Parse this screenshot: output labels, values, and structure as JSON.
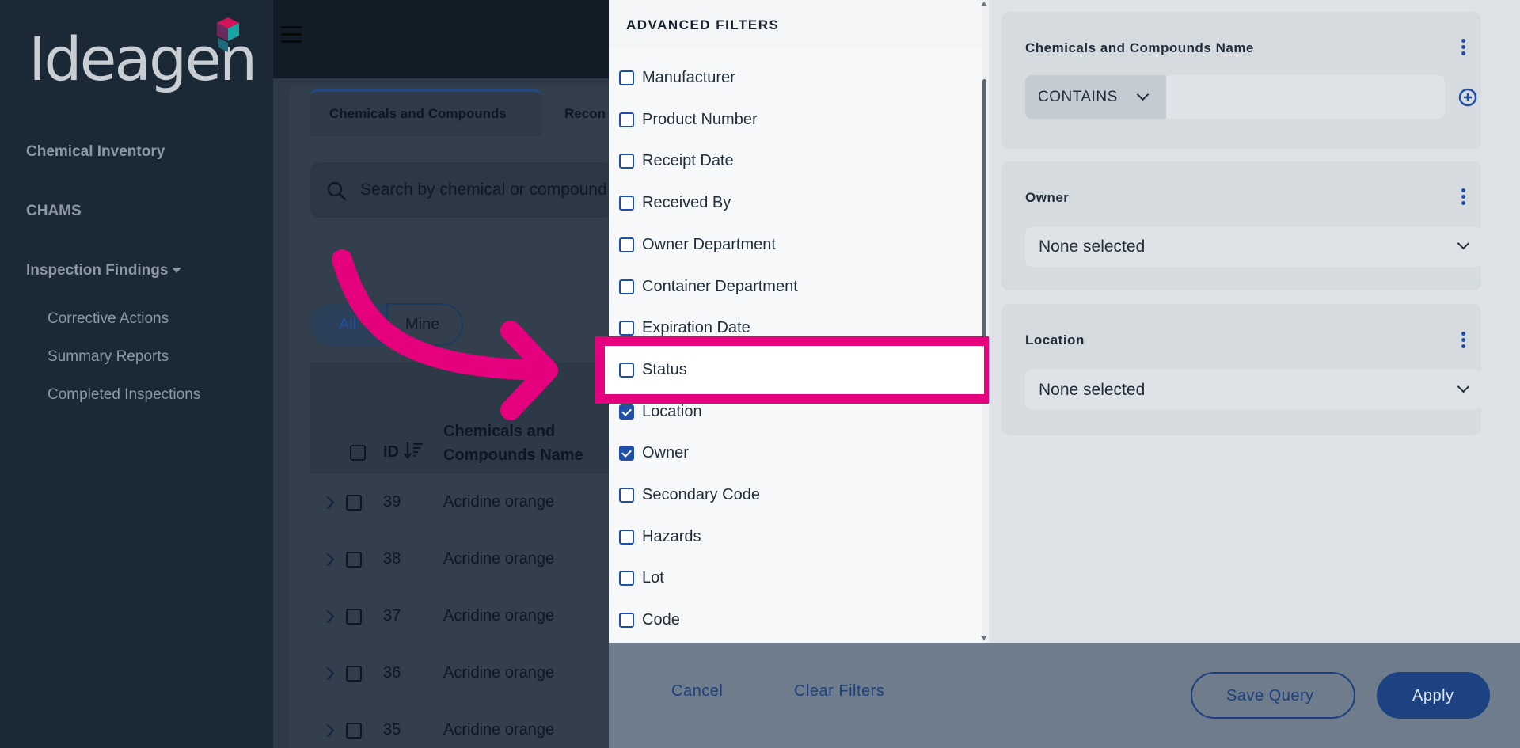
{
  "brand": {
    "logo_text": "Ideagen",
    "accent": "#e5007e"
  },
  "sidebar": {
    "items": [
      {
        "label": "Chemical Inventory"
      },
      {
        "label": "CHAMS"
      },
      {
        "label": "Inspection Findings"
      }
    ],
    "subitems": [
      {
        "label": "Corrective Actions"
      },
      {
        "label": "Summary Reports"
      },
      {
        "label": "Completed Inspections"
      }
    ]
  },
  "main": {
    "tabs": [
      {
        "label": "Chemicals and Compounds"
      },
      {
        "label": "Recon"
      }
    ],
    "search_placeholder": "Search by chemical or compound",
    "toggle": {
      "all": "All",
      "mine": "Mine"
    },
    "table": {
      "headers": {
        "id": "ID",
        "name_line1": "Chemicals and",
        "name_line2": "Compounds Name"
      },
      "rows": [
        {
          "id": "39",
          "name": "Acridine orange"
        },
        {
          "id": "38",
          "name": "Acridine orange"
        },
        {
          "id": "37",
          "name": "Acridine orange"
        },
        {
          "id": "36",
          "name": "Acridine orange"
        },
        {
          "id": "35",
          "name": "Acridine orange"
        }
      ]
    }
  },
  "filters": {
    "title": "ADVANCED FILTERS",
    "items": [
      {
        "label": "Manufacturer",
        "checked": false
      },
      {
        "label": "Product Number",
        "checked": false
      },
      {
        "label": "Receipt Date",
        "checked": false
      },
      {
        "label": "Received By",
        "checked": false
      },
      {
        "label": "Owner Department",
        "checked": false
      },
      {
        "label": "Container Department",
        "checked": false
      },
      {
        "label": "Expiration Date",
        "checked": false
      },
      {
        "label": "Status",
        "checked": false
      },
      {
        "label": "Location",
        "checked": true
      },
      {
        "label": "Owner",
        "checked": true
      },
      {
        "label": "Secondary Code",
        "checked": false
      },
      {
        "label": "Hazards",
        "checked": false
      },
      {
        "label": "Lot",
        "checked": false
      },
      {
        "label": "Code",
        "checked": false
      }
    ]
  },
  "query": {
    "name_filter": {
      "label": "Chemicals and Compounds Name",
      "operator": "CONTAINS",
      "value": ""
    },
    "owner": {
      "label": "Owner",
      "value": "None selected"
    },
    "location": {
      "label": "Location",
      "value": "None selected"
    }
  },
  "footer": {
    "cancel": "Cancel",
    "clear": "Clear Filters",
    "save": "Save Query",
    "apply": "Apply"
  }
}
